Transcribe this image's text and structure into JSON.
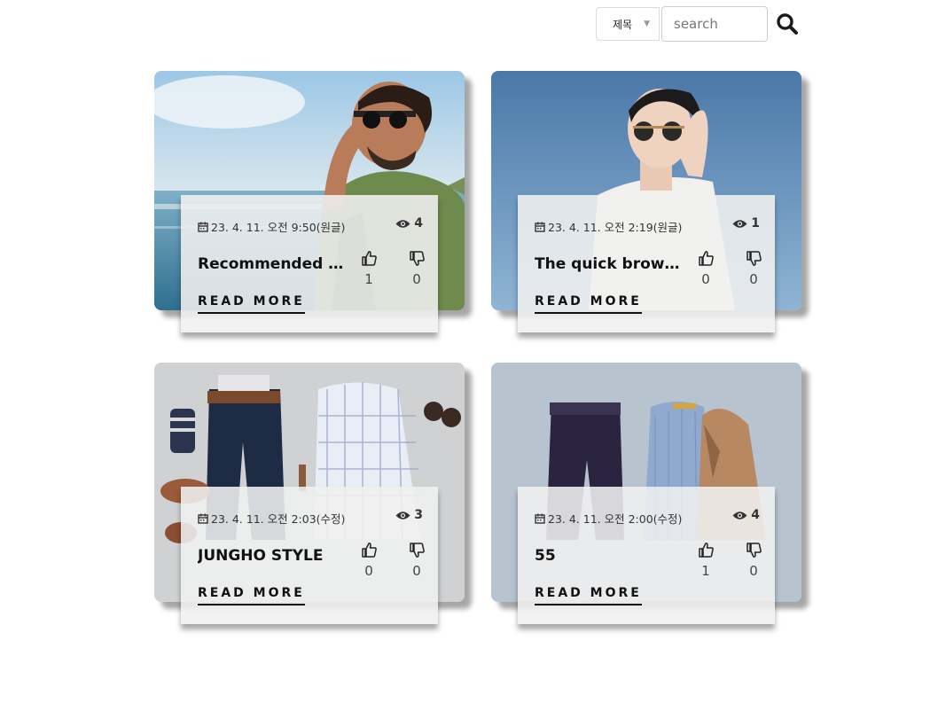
{
  "search": {
    "field_select": "제목",
    "placeholder": "search"
  },
  "posts": [
    {
      "date": "23. 4. 11. 오전 9:50(원글)",
      "views": "4",
      "title": "Recommended Sty...",
      "likes": "1",
      "dislikes": "0",
      "read_more": "READ MORE"
    },
    {
      "date": "23. 4. 11. 오전 2:19(원글)",
      "views": "1",
      "title": "The quick brown...",
      "likes": "0",
      "dislikes": "0",
      "read_more": "READ MORE"
    },
    {
      "date": "23. 4. 11. 오전 2:03(수정)",
      "views": "3",
      "title": "JUNGHO STYLE",
      "likes": "0",
      "dislikes": "0",
      "read_more": "READ MORE"
    },
    {
      "date": "23. 4. 11. 오전 2:00(수정)",
      "views": "4",
      "title": "55",
      "likes": "1",
      "dislikes": "0",
      "read_more": "READ MORE"
    }
  ],
  "icons": {
    "search": "magnifier-icon",
    "date": "calendar-icon",
    "views": "eye-icon",
    "like": "thumbs-up-icon",
    "dislike": "thumbs-down-icon"
  }
}
